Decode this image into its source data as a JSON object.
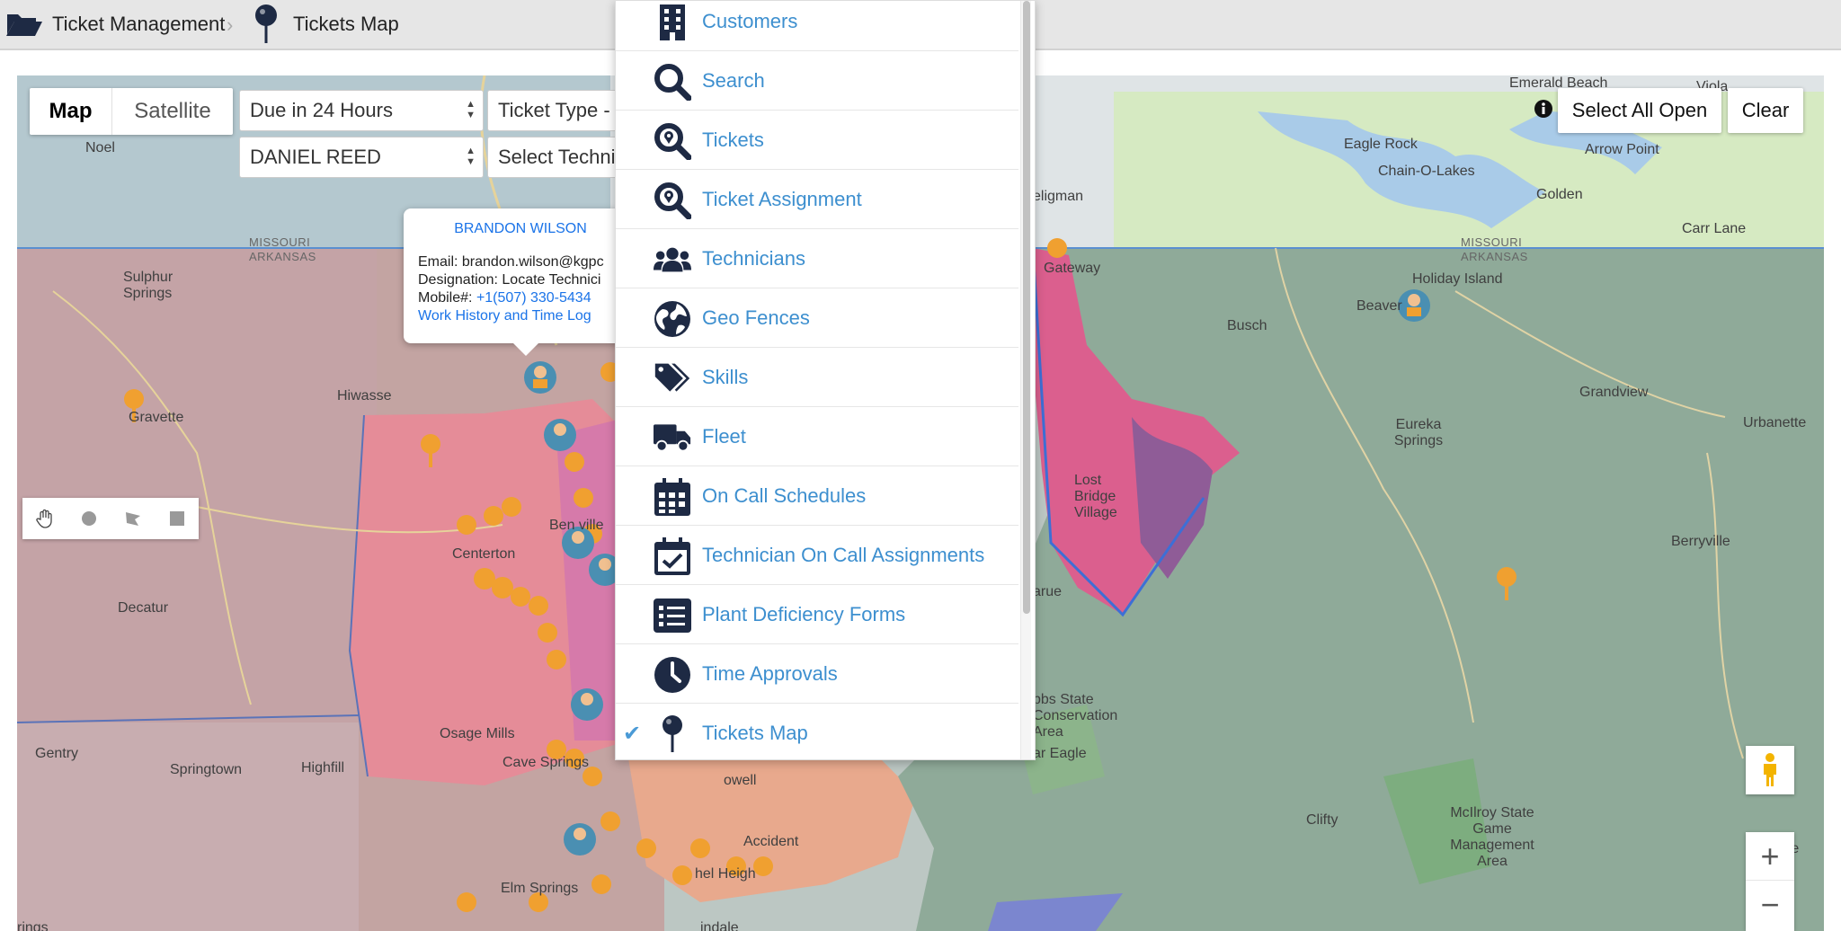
{
  "breadcrumb": {
    "root": "Ticket Management",
    "current": "Tickets Map"
  },
  "map_controls": {
    "map_type": [
      "Map",
      "Satellite"
    ],
    "due_filter": "Due in 24 Hours",
    "ticket_type": "Ticket Type -",
    "technician_filter": "DANIEL REED",
    "select_technician": "Select Techni",
    "select_all_open": "Select All Open",
    "clear": "Clear",
    "zoom_in": "+",
    "zoom_out": "−"
  },
  "popup": {
    "name": "BRANDON WILSON",
    "email_label": "Email:",
    "email": "brandon.wilson@kgpc",
    "designation_label": "Designation:",
    "designation": "Locate Technici",
    "mobile_label": "Mobile#:",
    "mobile": "+1(507) 330-5434",
    "link": "Work History and Time Log"
  },
  "menu": {
    "items": [
      {
        "label": "Customers",
        "icon": "building-icon"
      },
      {
        "label": "Search",
        "icon": "search-icon"
      },
      {
        "label": "Tickets",
        "icon": "search-location-icon"
      },
      {
        "label": "Ticket Assignment",
        "icon": "search-location-icon"
      },
      {
        "label": "Technicians",
        "icon": "users-icon"
      },
      {
        "label": "Geo Fences",
        "icon": "globe-icon"
      },
      {
        "label": "Skills",
        "icon": "tags-icon"
      },
      {
        "label": "Fleet",
        "icon": "truck-icon"
      },
      {
        "label": "On Call Schedules",
        "icon": "calendar-icon"
      },
      {
        "label": "Technician On Call Assignments",
        "icon": "calendar-check-icon"
      },
      {
        "label": "Plant Deficiency Forms",
        "icon": "list-icon"
      },
      {
        "label": "Time Approvals",
        "icon": "clock-icon"
      },
      {
        "label": "Tickets Map",
        "icon": "map-pin-icon",
        "selected": true
      }
    ],
    "check_glyph": "✔"
  },
  "map_labels": {
    "noel": "Noel",
    "missouri_w": "MISSOURI",
    "arkansas_w": "ARKANSAS",
    "sulphur_springs": "Sulphur Springs",
    "gravette": "Gravette",
    "hiwasse": "Hiwasse",
    "centerton": "Centerton",
    "decatur": "Decatur",
    "gentry": "Gentry",
    "springtown": "Springtown",
    "highfill": "Highfill",
    "osage_mills": "Osage Mills",
    "cave_springs": "Cave Springs",
    "elm_springs": "Elm Springs",
    "accident": "Accident",
    "lowell": "owell",
    "bentonville": "Ben ville",
    "seligman": "eligman",
    "gateway": "Gateway",
    "emerald_beach": "Emerald Beach",
    "viola": "Viola",
    "eagle_rock": "Eagle Rock",
    "arrow_point": "Arrow Point",
    "chain_o_lakes": "Chain-O-Lakes",
    "golden": "Golden",
    "carr_lane": "Carr Lane",
    "missouri_e": "MISSOURI",
    "arkansas_e": "ARKANSAS",
    "holiday_island": "Holiday Island",
    "busch": "Busch",
    "beaver": "Beaver",
    "grandview": "Grandview",
    "urbanette": "Urbanette",
    "eureka_springs": "Eureka Springs",
    "lost_bridge_village": "Lost Bridge Village",
    "berryville": "Berryville",
    "garfield": "arue",
    "hobbs": "bbs State Conservation Area",
    "clifty": "Clifty",
    "mcilroy": "McIlroy State Game Management Area",
    "war_eagle": "ar Eagle",
    "heights": "hel Heigh",
    "tindale": "indale",
    "rings": "rings",
    "me": "Me"
  }
}
